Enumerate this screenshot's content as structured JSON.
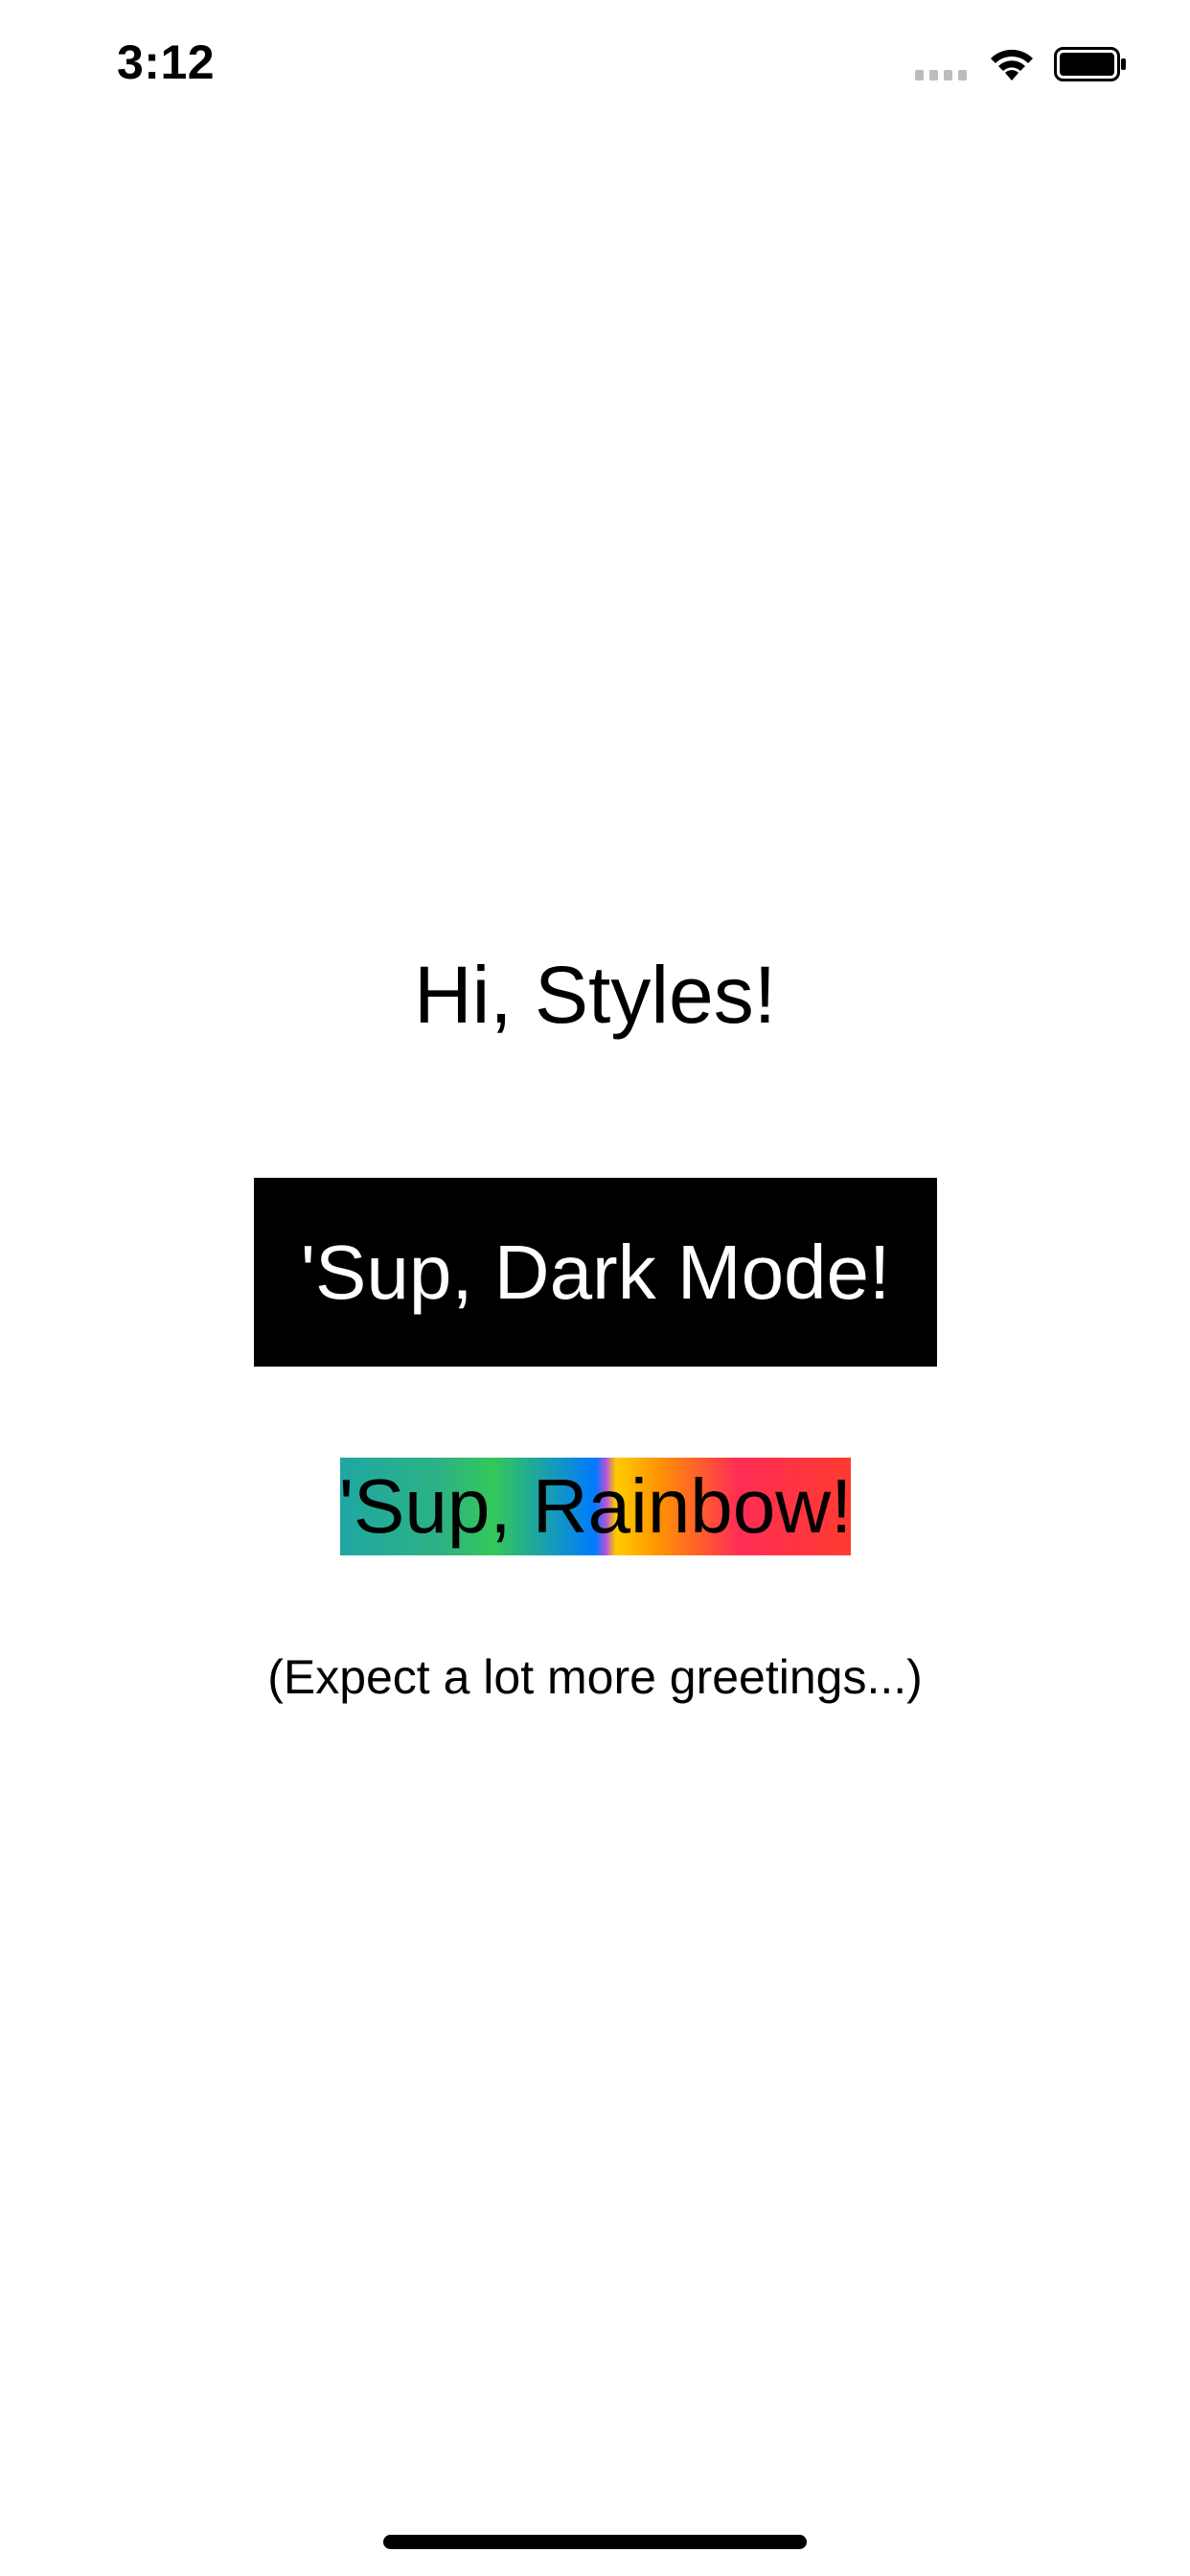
{
  "status_bar": {
    "time": "3:12",
    "signal_icon": "signal-dots-icon",
    "wifi_icon": "wifi-icon",
    "battery_icon": "battery-full-icon"
  },
  "main": {
    "title": "Hi, Styles!",
    "dark_button_label": "'Sup, Dark Mode!",
    "rainbow_button_label": "'Sup, Rainbow!",
    "footnote": "(Expect a lot more greetings...)"
  },
  "colors": {
    "background": "#ffffff",
    "text": "#000000",
    "dark_button_bg": "#000000",
    "dark_button_text": "#ffffff",
    "rainbow": [
      "#1fa7a3",
      "#34c759",
      "#007aff",
      "#af52de",
      "#ffcc00",
      "#ff9500",
      "#ff2d55",
      "#ff3b30"
    ]
  }
}
